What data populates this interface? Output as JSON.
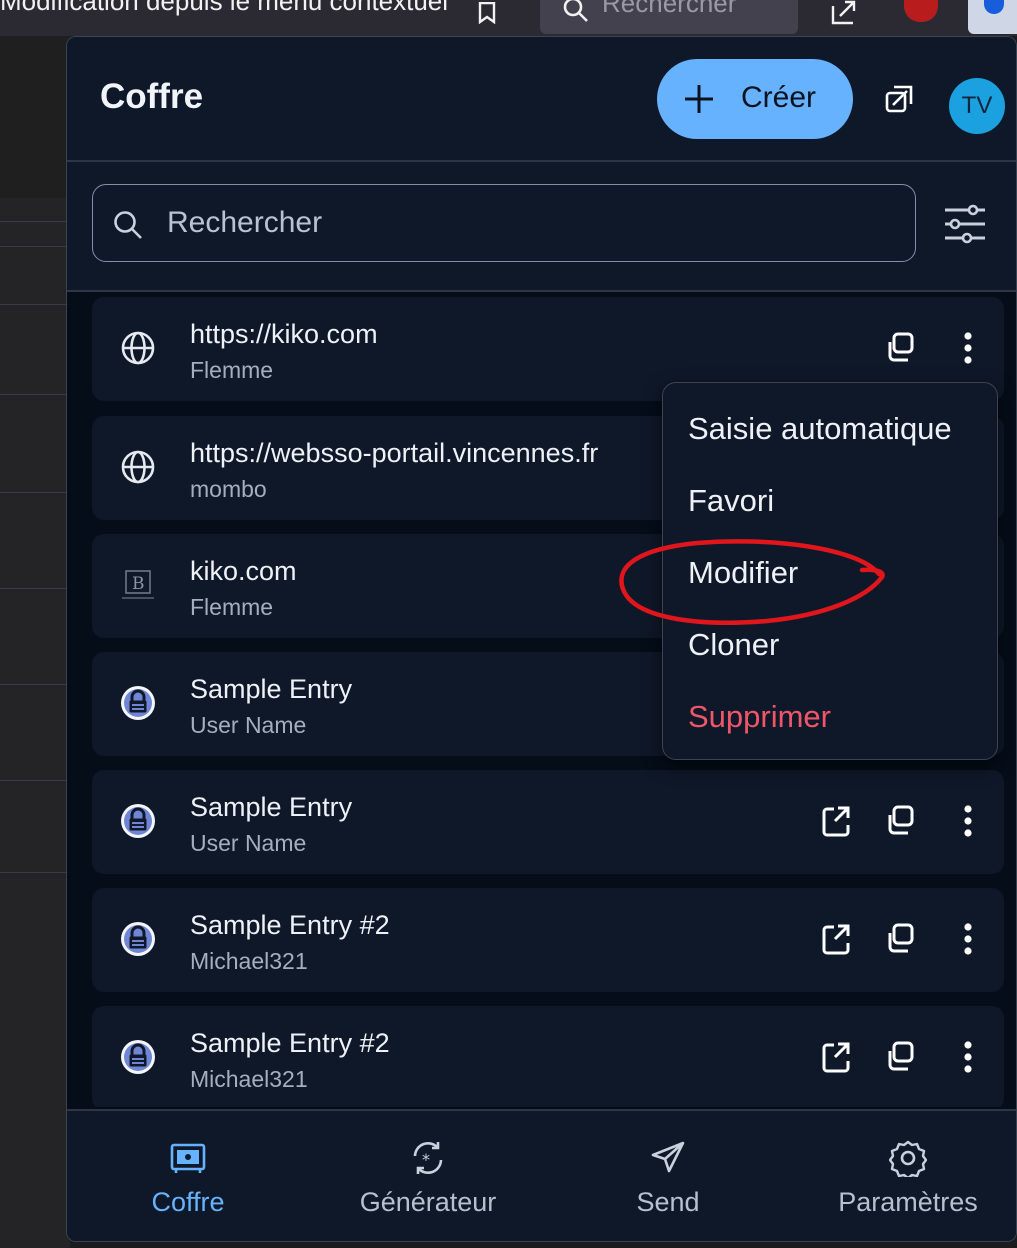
{
  "browser": {
    "cut_text": "Modification depuis le menu contextuel",
    "search_placeholder": "Rechercher"
  },
  "header": {
    "title": "Coffre",
    "create_label": "Créer",
    "avatar_initials": "TV"
  },
  "search": {
    "placeholder": "Rechercher"
  },
  "items": [
    {
      "title": "https://kiko.com",
      "subtitle": "Flemme",
      "icon": "globe-icon",
      "actions": [
        "copy-icon",
        "more-icon"
      ]
    },
    {
      "title": "https://websso-portail.vincennes.fr",
      "subtitle": "mombo",
      "icon": "globe-icon",
      "actions": []
    },
    {
      "title": "kiko.com",
      "subtitle": "Flemme",
      "icon": "site-favicon-icon",
      "actions": []
    },
    {
      "title": "Sample Entry",
      "subtitle": "User Name",
      "icon": "keepass-lock-icon",
      "actions": []
    },
    {
      "title": "Sample Entry",
      "subtitle": "User Name",
      "icon": "keepass-lock-icon",
      "actions": [
        "launch-icon",
        "copy-icon",
        "more-icon"
      ]
    },
    {
      "title": "Sample Entry #2",
      "subtitle": "Michael321",
      "icon": "keepass-lock-icon",
      "actions": [
        "launch-icon",
        "copy-icon",
        "more-icon"
      ]
    },
    {
      "title": "Sample Entry #2",
      "subtitle": "Michael321",
      "icon": "keepass-lock-icon",
      "actions": [
        "launch-icon",
        "copy-icon",
        "more-icon"
      ]
    }
  ],
  "menu": {
    "items": [
      "Saisie automatique",
      "Favori",
      "Modifier",
      "Cloner",
      "Supprimer"
    ],
    "highlighted": "Modifier",
    "danger": "Supprimer"
  },
  "nav": {
    "tabs": [
      {
        "label": "Coffre",
        "icon": "vault-icon",
        "active": true
      },
      {
        "label": "Générateur",
        "icon": "generator-icon",
        "active": false
      },
      {
        "label": "Send",
        "icon": "send-icon",
        "active": false
      },
      {
        "label": "Paramètres",
        "icon": "gear-icon",
        "active": false
      }
    ]
  },
  "colors": {
    "accent": "#66b2ff",
    "background": "#040d18",
    "surface": "#0f1829",
    "danger": "#f0566a",
    "annotation": "#e0161c"
  }
}
